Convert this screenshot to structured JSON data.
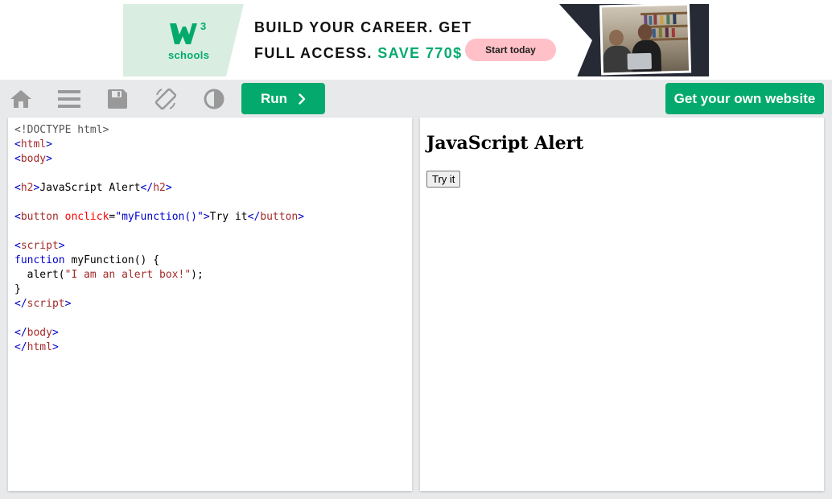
{
  "ad": {
    "logo_sup": "3",
    "logo_text": "schools",
    "line1": "BUILD YOUR CAREER. GET",
    "line2_prefix": "FULL ACCESS. ",
    "line2_accent": "SAVE 770$",
    "cta": "Start today",
    "colors": {
      "accent": "#04aa6d",
      "cta_bg": "#ffc0c7",
      "panel_bg": "#d9eee1",
      "dark": "#262a35"
    }
  },
  "toolbar": {
    "icons": [
      "home-icon",
      "menu-icon",
      "save-icon",
      "rotate-icon",
      "contrast-icon"
    ],
    "run_label": "Run",
    "run_icon": "chevron-right-icon",
    "get_website_label": "Get your own website",
    "colors": {
      "button": "#04aa6d",
      "icon": "#999999"
    }
  },
  "editor": {
    "doctype": "<!DOCTYPE html>",
    "html_open": "html",
    "body_open": "body",
    "h2_tag": "h2",
    "h2_text": "JavaScript Alert",
    "button_tag": "button",
    "onclick_attr": "onclick",
    "onclick_value": "\"myFunction()\"",
    "button_text": "Try it",
    "script_tag": "script",
    "fn_keyword": "function",
    "fn_signature": " myFunction() {",
    "alert_call": "  alert(",
    "alert_string": "\"I am an alert box!\"",
    "alert_end": ");",
    "close_brace": "}",
    "body_close": "body",
    "html_close": "html"
  },
  "result": {
    "heading": "JavaScript Alert",
    "button_label": "Try it"
  }
}
